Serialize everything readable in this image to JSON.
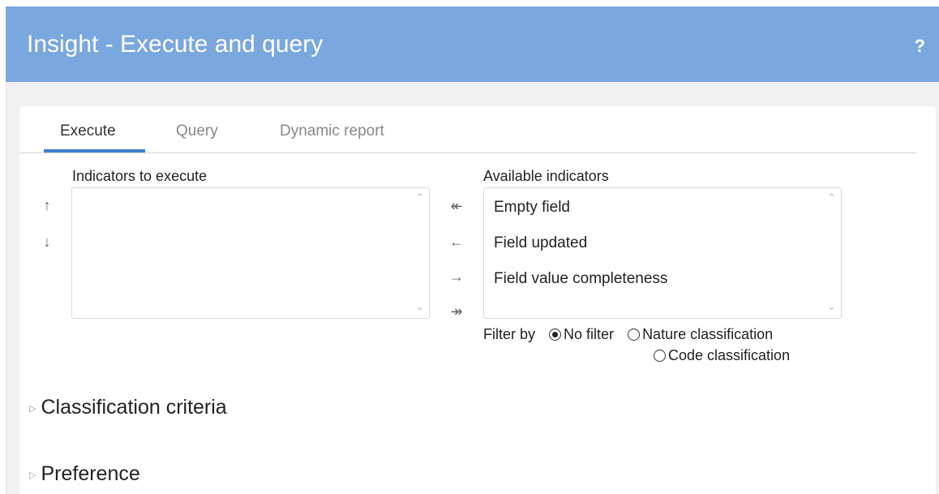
{
  "header": {
    "title": "Insight - Execute and query",
    "help": "?"
  },
  "tabs": [
    {
      "label": "Execute",
      "active": true
    },
    {
      "label": "Query",
      "active": false
    },
    {
      "label": "Dynamic report",
      "active": false
    }
  ],
  "execute": {
    "indicators_to_execute": {
      "label": "Indicators to execute",
      "items": []
    },
    "order_controls": {
      "up": "↑",
      "down": "↓"
    },
    "transfer_controls": {
      "move_all_left": "↞",
      "move_left": "←",
      "move_right": "→",
      "move_all_right": "↠"
    },
    "available_indicators": {
      "label": "Available indicators",
      "items": [
        "Empty field",
        "Field updated",
        "Field value completeness"
      ]
    },
    "filter": {
      "label": "Filter by",
      "options": [
        "No filter",
        "Nature classification",
        "Code classification"
      ],
      "selected": "No filter"
    }
  },
  "sections": [
    "Classification criteria",
    "Preference"
  ],
  "icons": {
    "scroll_up": "chevron-up-icon",
    "scroll_down": "chevron-down-icon",
    "expand": "triangle-right-icon"
  },
  "colors": {
    "header": "#7aa7dd",
    "accent": "#3f7fcf"
  }
}
